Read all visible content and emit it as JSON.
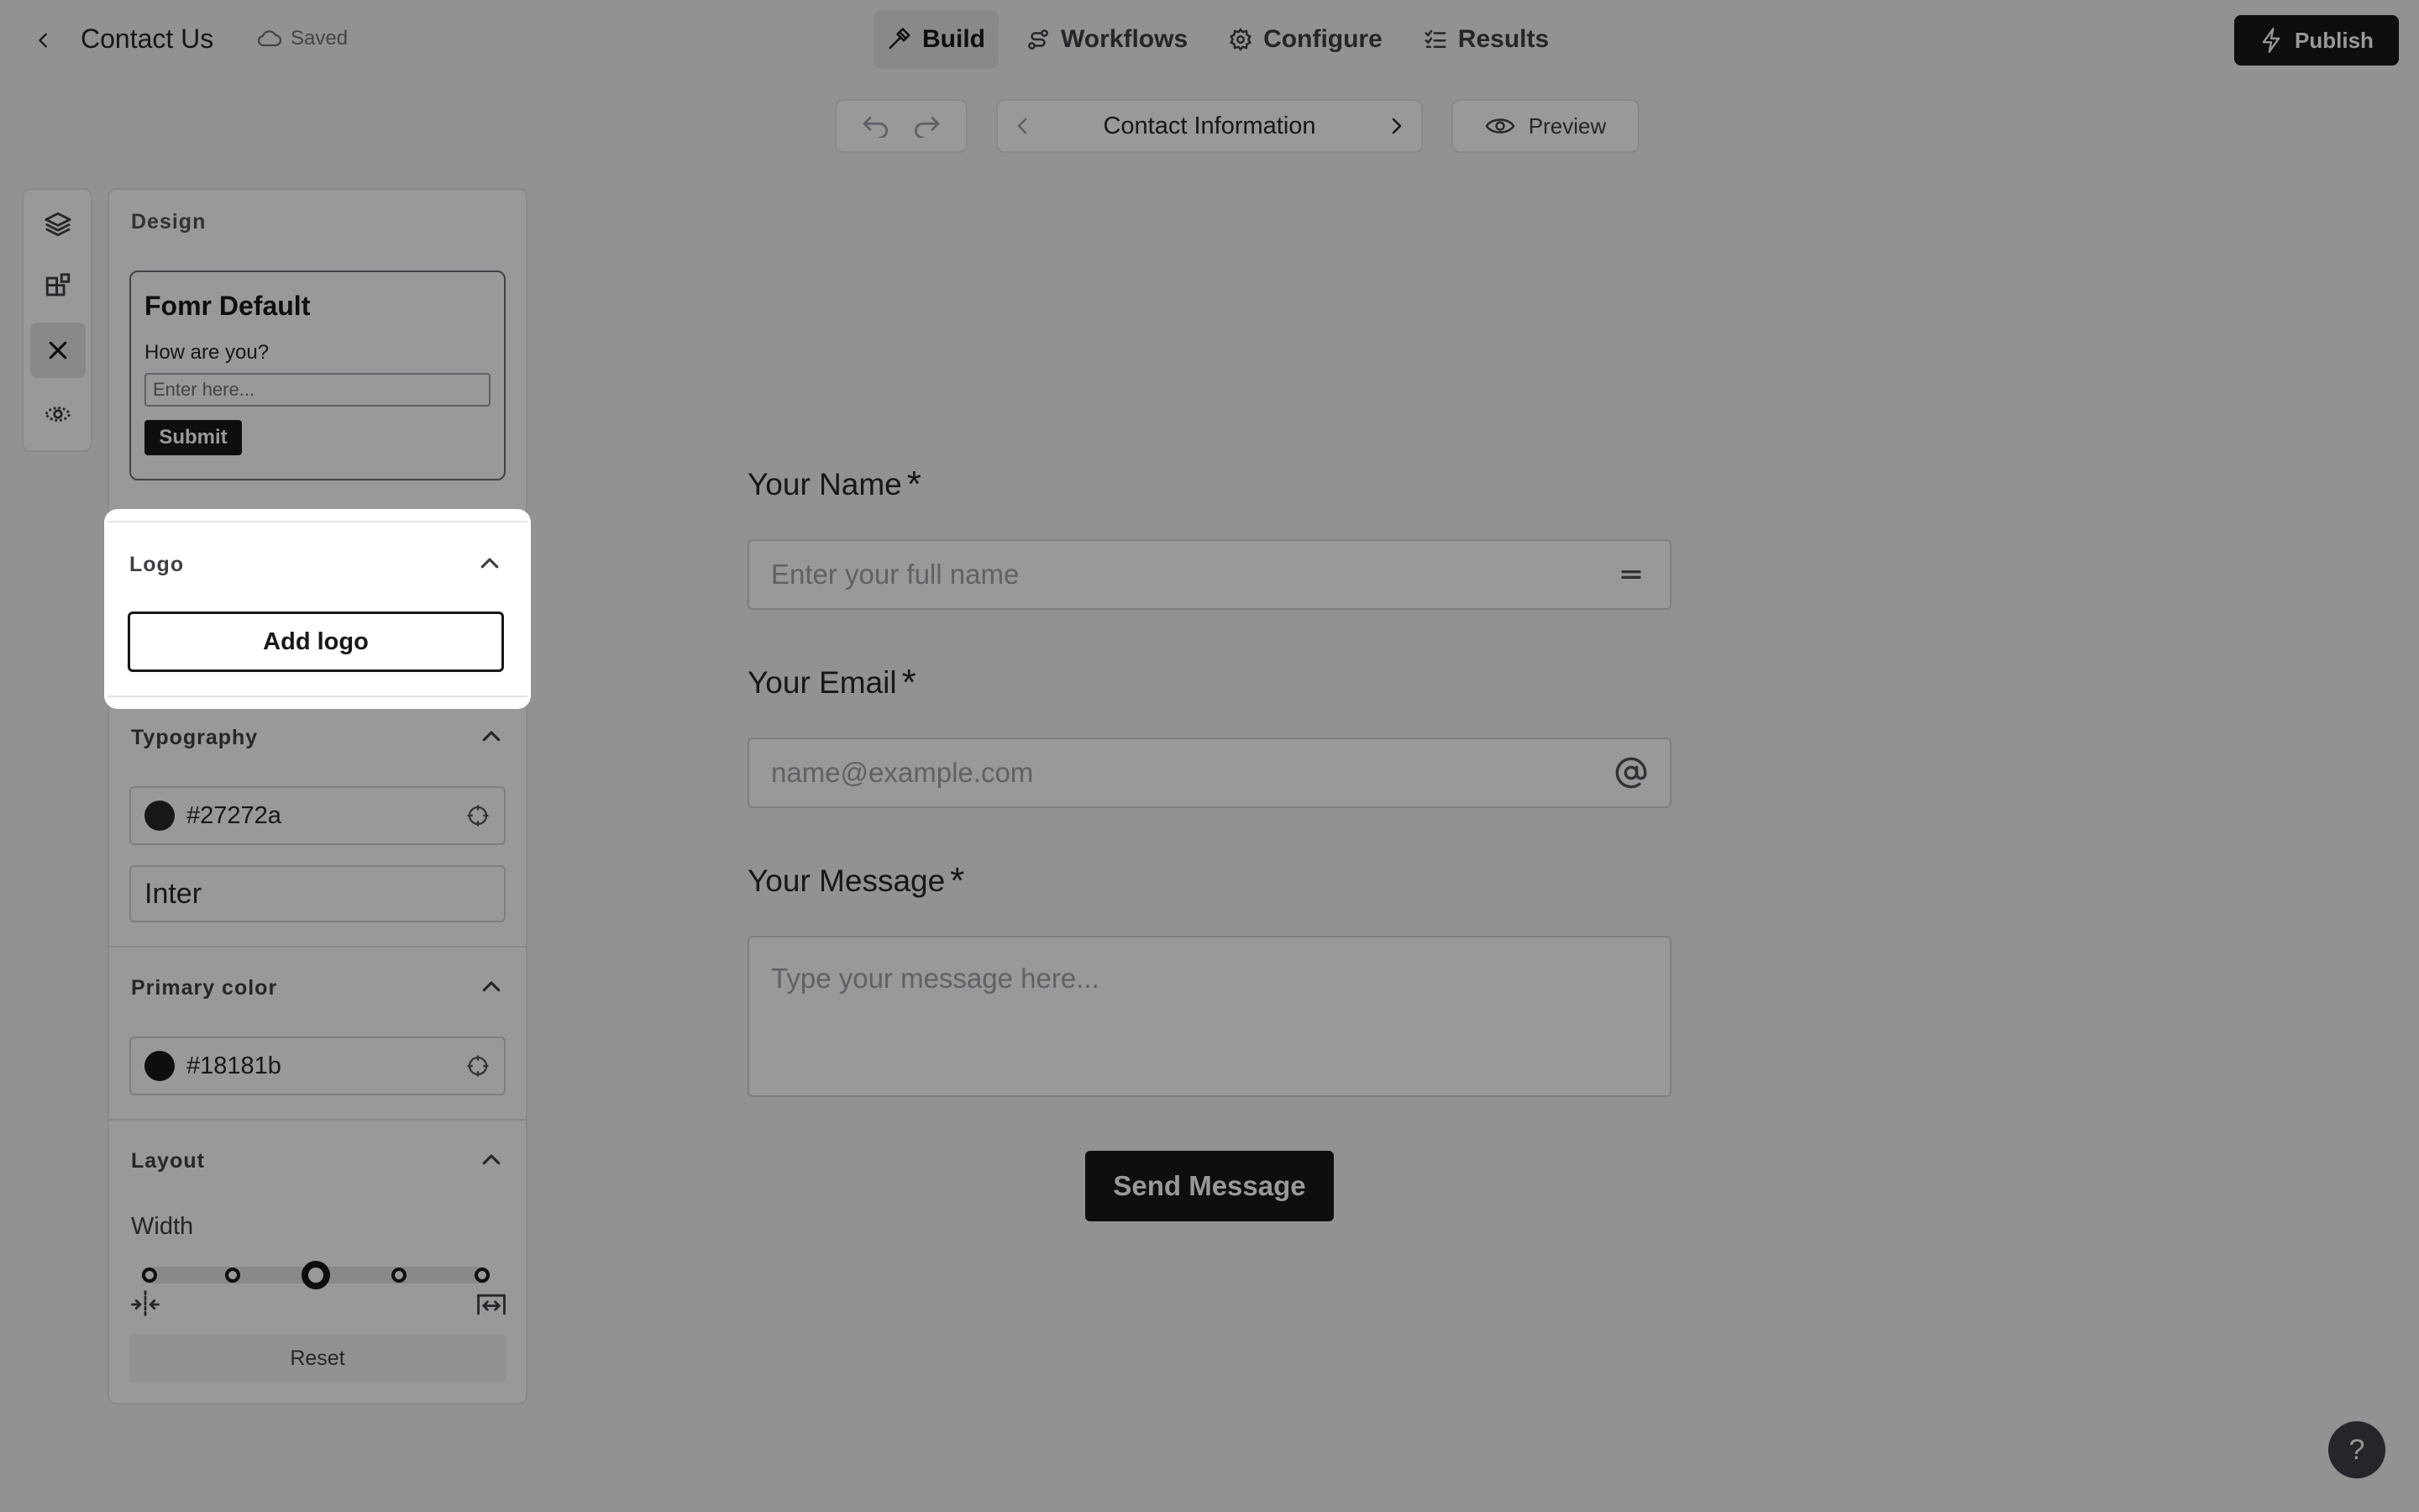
{
  "header": {
    "title": "Contact Us",
    "save_status": "Saved",
    "tabs": [
      {
        "label": "Build",
        "icon": "hammer-icon",
        "active": true
      },
      {
        "label": "Workflows",
        "icon": "workflow-icon",
        "active": false
      },
      {
        "label": "Configure",
        "icon": "gear-icon",
        "active": false
      },
      {
        "label": "Results",
        "icon": "list-checks-icon",
        "active": false
      }
    ],
    "publish_label": "Publish"
  },
  "toolbar": {
    "page_name": "Contact Information",
    "preview_label": "Preview"
  },
  "rail": {
    "items": [
      "layers-icon",
      "blocks-icon",
      "close-icon",
      "eye-settings-icon"
    ],
    "active_index": 2
  },
  "design_panel": {
    "heading": "Design",
    "preset": {
      "name": "Fomr Default",
      "question": "How are you?",
      "placeholder": "Enter here...",
      "submit": "Submit"
    },
    "logo": {
      "title": "Logo",
      "button": "Add logo"
    },
    "typography": {
      "title": "Typography",
      "color": "#27272a",
      "font": "Inter"
    },
    "primary_color": {
      "title": "Primary color",
      "color": "#18181b"
    },
    "layout": {
      "title": "Layout",
      "width_label": "Width",
      "width_steps": 5,
      "width_selected_step": 3,
      "reset_label": "Reset"
    }
  },
  "form": {
    "fields": [
      {
        "label": "Your Name",
        "required_mark": "*",
        "placeholder": "Enter your full name",
        "icon": "text-lines-icon"
      },
      {
        "label": "Your Email",
        "required_mark": "*",
        "placeholder": "name@example.com",
        "icon": "at-icon"
      },
      {
        "label": "Your Message",
        "required_mark": "*",
        "placeholder": "Type your message here..."
      }
    ],
    "submit_label": "Send Message"
  },
  "help_label": "?",
  "colors": {
    "dark": "#18181b",
    "text": "#27272a",
    "background": "#f4f4f5",
    "overlay": "rgba(0,0,0,0.4)"
  }
}
